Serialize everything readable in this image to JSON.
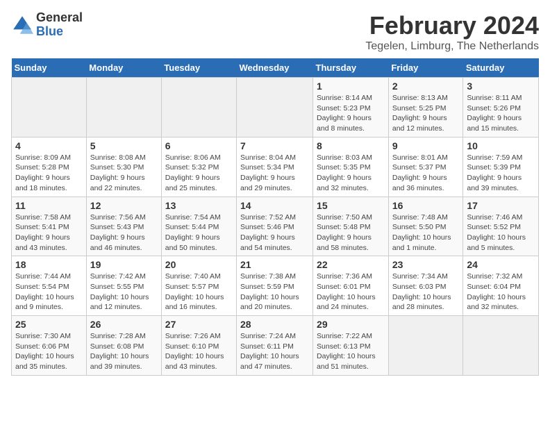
{
  "app": {
    "logo_general": "General",
    "logo_blue": "Blue"
  },
  "header": {
    "title": "February 2024",
    "subtitle": "Tegelen, Limburg, The Netherlands"
  },
  "calendar": {
    "days_of_week": [
      "Sunday",
      "Monday",
      "Tuesday",
      "Wednesday",
      "Thursday",
      "Friday",
      "Saturday"
    ],
    "weeks": [
      [
        {
          "day": "",
          "info": ""
        },
        {
          "day": "",
          "info": ""
        },
        {
          "day": "",
          "info": ""
        },
        {
          "day": "",
          "info": ""
        },
        {
          "day": "1",
          "info": "Sunrise: 8:14 AM\nSunset: 5:23 PM\nDaylight: 9 hours\nand 8 minutes."
        },
        {
          "day": "2",
          "info": "Sunrise: 8:13 AM\nSunset: 5:25 PM\nDaylight: 9 hours\nand 12 minutes."
        },
        {
          "day": "3",
          "info": "Sunrise: 8:11 AM\nSunset: 5:26 PM\nDaylight: 9 hours\nand 15 minutes."
        }
      ],
      [
        {
          "day": "4",
          "info": "Sunrise: 8:09 AM\nSunset: 5:28 PM\nDaylight: 9 hours\nand 18 minutes."
        },
        {
          "day": "5",
          "info": "Sunrise: 8:08 AM\nSunset: 5:30 PM\nDaylight: 9 hours\nand 22 minutes."
        },
        {
          "day": "6",
          "info": "Sunrise: 8:06 AM\nSunset: 5:32 PM\nDaylight: 9 hours\nand 25 minutes."
        },
        {
          "day": "7",
          "info": "Sunrise: 8:04 AM\nSunset: 5:34 PM\nDaylight: 9 hours\nand 29 minutes."
        },
        {
          "day": "8",
          "info": "Sunrise: 8:03 AM\nSunset: 5:35 PM\nDaylight: 9 hours\nand 32 minutes."
        },
        {
          "day": "9",
          "info": "Sunrise: 8:01 AM\nSunset: 5:37 PM\nDaylight: 9 hours\nand 36 minutes."
        },
        {
          "day": "10",
          "info": "Sunrise: 7:59 AM\nSunset: 5:39 PM\nDaylight: 9 hours\nand 39 minutes."
        }
      ],
      [
        {
          "day": "11",
          "info": "Sunrise: 7:58 AM\nSunset: 5:41 PM\nDaylight: 9 hours\nand 43 minutes."
        },
        {
          "day": "12",
          "info": "Sunrise: 7:56 AM\nSunset: 5:43 PM\nDaylight: 9 hours\nand 46 minutes."
        },
        {
          "day": "13",
          "info": "Sunrise: 7:54 AM\nSunset: 5:44 PM\nDaylight: 9 hours\nand 50 minutes."
        },
        {
          "day": "14",
          "info": "Sunrise: 7:52 AM\nSunset: 5:46 PM\nDaylight: 9 hours\nand 54 minutes."
        },
        {
          "day": "15",
          "info": "Sunrise: 7:50 AM\nSunset: 5:48 PM\nDaylight: 9 hours\nand 58 minutes."
        },
        {
          "day": "16",
          "info": "Sunrise: 7:48 AM\nSunset: 5:50 PM\nDaylight: 10 hours\nand 1 minute."
        },
        {
          "day": "17",
          "info": "Sunrise: 7:46 AM\nSunset: 5:52 PM\nDaylight: 10 hours\nand 5 minutes."
        }
      ],
      [
        {
          "day": "18",
          "info": "Sunrise: 7:44 AM\nSunset: 5:54 PM\nDaylight: 10 hours\nand 9 minutes."
        },
        {
          "day": "19",
          "info": "Sunrise: 7:42 AM\nSunset: 5:55 PM\nDaylight: 10 hours\nand 12 minutes."
        },
        {
          "day": "20",
          "info": "Sunrise: 7:40 AM\nSunset: 5:57 PM\nDaylight: 10 hours\nand 16 minutes."
        },
        {
          "day": "21",
          "info": "Sunrise: 7:38 AM\nSunset: 5:59 PM\nDaylight: 10 hours\nand 20 minutes."
        },
        {
          "day": "22",
          "info": "Sunrise: 7:36 AM\nSunset: 6:01 PM\nDaylight: 10 hours\nand 24 minutes."
        },
        {
          "day": "23",
          "info": "Sunrise: 7:34 AM\nSunset: 6:03 PM\nDaylight: 10 hours\nand 28 minutes."
        },
        {
          "day": "24",
          "info": "Sunrise: 7:32 AM\nSunset: 6:04 PM\nDaylight: 10 hours\nand 32 minutes."
        }
      ],
      [
        {
          "day": "25",
          "info": "Sunrise: 7:30 AM\nSunset: 6:06 PM\nDaylight: 10 hours\nand 35 minutes."
        },
        {
          "day": "26",
          "info": "Sunrise: 7:28 AM\nSunset: 6:08 PM\nDaylight: 10 hours\nand 39 minutes."
        },
        {
          "day": "27",
          "info": "Sunrise: 7:26 AM\nSunset: 6:10 PM\nDaylight: 10 hours\nand 43 minutes."
        },
        {
          "day": "28",
          "info": "Sunrise: 7:24 AM\nSunset: 6:11 PM\nDaylight: 10 hours\nand 47 minutes."
        },
        {
          "day": "29",
          "info": "Sunrise: 7:22 AM\nSunset: 6:13 PM\nDaylight: 10 hours\nand 51 minutes."
        },
        {
          "day": "",
          "info": ""
        },
        {
          "day": "",
          "info": ""
        }
      ]
    ]
  }
}
